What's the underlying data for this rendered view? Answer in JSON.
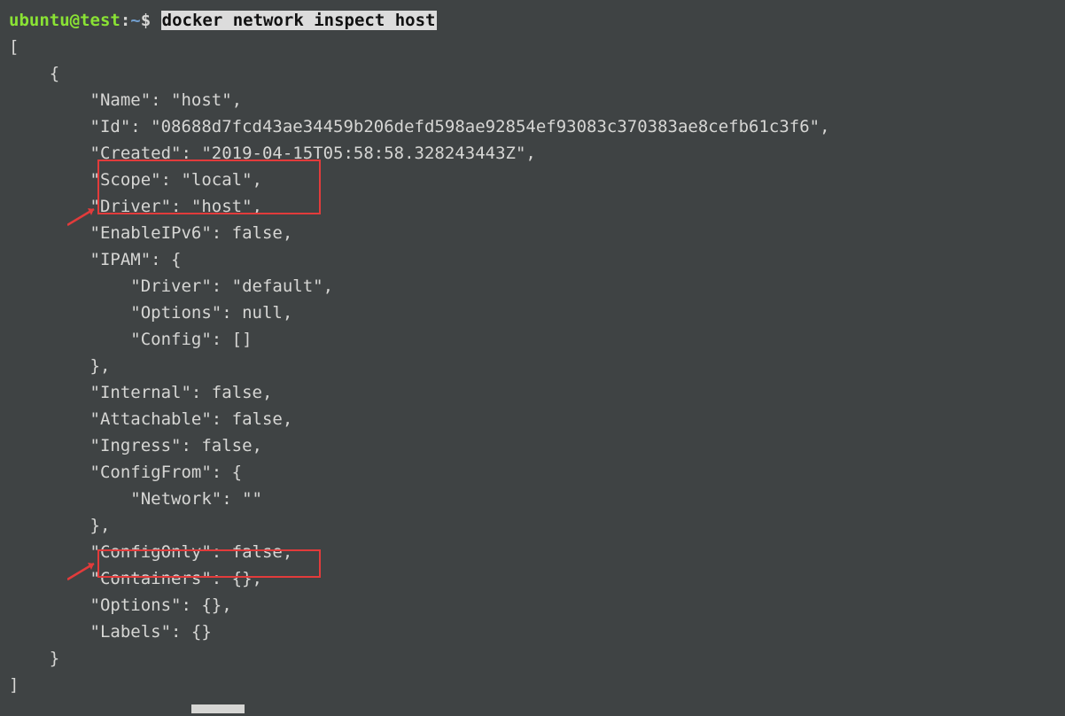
{
  "prompt": {
    "user_host": "ubuntu@test",
    "colon": ":",
    "path": "~",
    "dollar": "$ "
  },
  "command": "docker network inspect host",
  "lines": {
    "l0": "[",
    "l1": "    {",
    "l2": "        \"Name\": \"host\",",
    "l3": "        \"Id\": \"08688d7fcd43ae34459b206defd598ae92854ef93083c370383ae8cefb61c3f6\",",
    "l4": "        \"Created\": \"2019-04-15T05:58:58.328243443Z\",",
    "l5": "        \"Scope\": \"local\",",
    "l6": "        \"Driver\": \"host\",",
    "l7": "        \"EnableIPv6\": false,",
    "l8": "        \"IPAM\": {",
    "l9": "            \"Driver\": \"default\",",
    "l10": "            \"Options\": null,",
    "l11": "            \"Config\": []",
    "l12": "        },",
    "l13": "        \"Internal\": false,",
    "l14": "        \"Attachable\": false,",
    "l15": "        \"Ingress\": false,",
    "l16": "        \"ConfigFrom\": {",
    "l17": "            \"Network\": \"\"",
    "l18": "        },",
    "l19": "        \"ConfigOnly\": false,",
    "l20": "        \"Containers\": {},",
    "l21": "        \"Options\": {},",
    "l22": "        \"Labels\": {}",
    "l23": "    }",
    "l24": "]"
  },
  "output_data": {
    "Name": "host",
    "Id": "08688d7fcd43ae34459b206defd598ae92854ef93083c370383ae8cefb61c3f6",
    "Created": "2019-04-15T05:58:58.328243443Z",
    "Scope": "local",
    "Driver": "host",
    "EnableIPv6": false,
    "IPAM": {
      "Driver": "default",
      "Options": null,
      "Config": []
    },
    "Internal": false,
    "Attachable": false,
    "Ingress": false,
    "ConfigFrom": {
      "Network": ""
    },
    "ConfigOnly": false,
    "Containers": {},
    "Options": {},
    "Labels": {}
  }
}
